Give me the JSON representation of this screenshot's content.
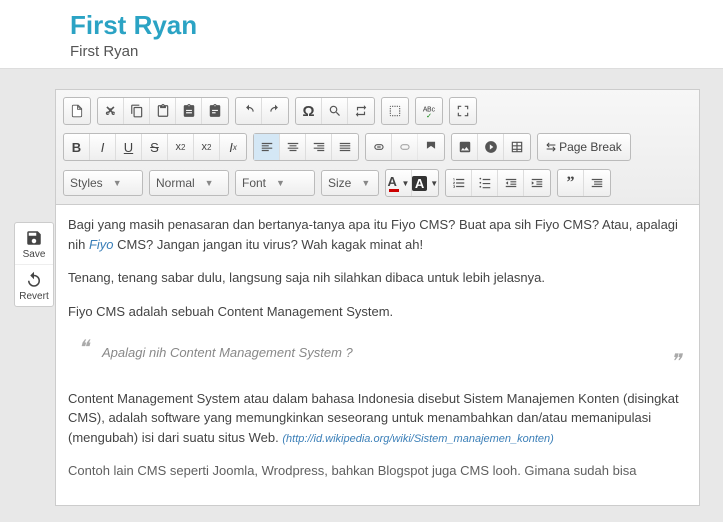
{
  "header": {
    "title": "First Ryan",
    "subtitle": "First Ryan"
  },
  "side": {
    "save": "Save",
    "revert": "Revert"
  },
  "toolbar": {
    "pagebreak": "Page Break",
    "styles": "Styles",
    "format": "Normal",
    "font": "Font",
    "size": "Size",
    "textcolor": "A",
    "bgcolor": "A"
  },
  "content": {
    "p1a": "Bagi yang masih penasaran dan bertanya-tanya apa itu Fiyo CMS? Buat apa sih Fiyo CMS? Atau, apalagi nih ",
    "p1link": "Fiyo",
    "p1b": " CMS? Jangan jangan itu virus? Wah kagak minat ah!",
    "p2": "Tenang, tenang sabar dulu, langsung saja nih silahkan dibaca untuk lebih jelasnya.",
    "p3": "Fiyo CMS adalah sebuah Content Management System.",
    "quote": "Apalagi nih Content Management System ?",
    "p4a": "Content Management System atau dalam bahasa Indonesia disebut Sistem Manajemen Konten (disingkat CMS), adalah software yang memungkinkan seseorang untuk menambahkan dan/atau memanipulasi (mengubah) isi dari suatu situs Web. ",
    "p4link": "(http://id.wikipedia.org/wiki/Sistem_manajemen_konten)",
    "p5": "Contoh lain CMS seperti Joomla, Wrodpress, bahkan Blogspot juga CMS looh. Gimana sudah bisa"
  }
}
